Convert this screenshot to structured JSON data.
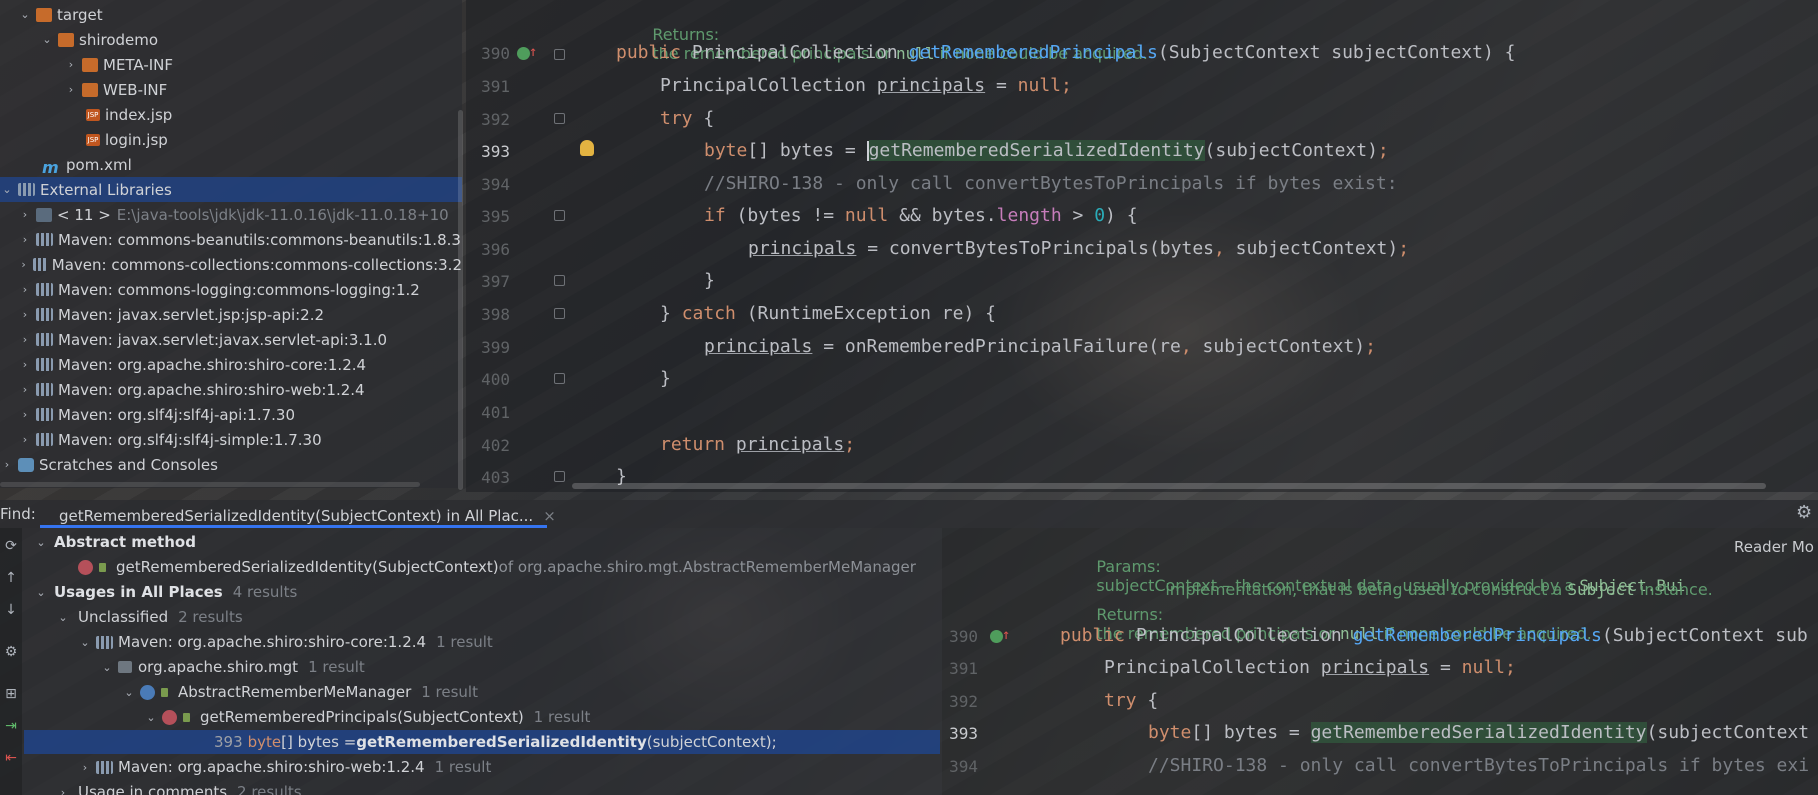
{
  "project_tree": {
    "rows": [
      {
        "label": "target",
        "dim": ""
      },
      {
        "label": "shirodemo",
        "dim": ""
      },
      {
        "label": "META-INF",
        "dim": ""
      },
      {
        "label": "WEB-INF",
        "dim": ""
      },
      {
        "label": "index.jsp",
        "dim": ""
      },
      {
        "label": "login.jsp",
        "dim": ""
      },
      {
        "label": "pom.xml",
        "dim": ""
      },
      {
        "label": "External Libraries",
        "dim": ""
      },
      {
        "label": "< 11 >",
        "dim": "E:\\java-tools\\jdk\\jdk-11.0.16\\jdk-11.0.18+10"
      },
      {
        "label": "Maven: commons-beanutils:commons-beanutils:1.8.3",
        "dim": ""
      },
      {
        "label": "Maven: commons-collections:commons-collections:3.2",
        "dim": ""
      },
      {
        "label": "Maven: commons-logging:commons-logging:1.2",
        "dim": ""
      },
      {
        "label": "Maven: javax.servlet.jsp:jsp-api:2.2",
        "dim": ""
      },
      {
        "label": "Maven: javax.servlet:javax.servlet-api:3.1.0",
        "dim": ""
      },
      {
        "label": "Maven: org.apache.shiro:shiro-core:1.2.4",
        "dim": ""
      },
      {
        "label": "Maven: org.apache.shiro:shiro-web:1.2.4",
        "dim": ""
      },
      {
        "label": "Maven: org.slf4j:slf4j-api:1.7.30",
        "dim": ""
      },
      {
        "label": "Maven: org.slf4j:slf4j-simple:1.7.30",
        "dim": ""
      },
      {
        "label": "Scratches and Consoles",
        "dim": ""
      }
    ]
  },
  "editor": {
    "doc_returns_label": "Returns:",
    "doc_returns_text_1": "the remembered principals or ",
    "doc_returns_null": "null",
    "doc_returns_text_2": " if none could be acquired.",
    "line_numbers": [
      "390",
      "391",
      "392",
      "393",
      "394",
      "395",
      "396",
      "397",
      "398",
      "399",
      "400",
      "401",
      "402",
      "403"
    ],
    "lines": {
      "l390_kw": "public",
      "l390_type": " PrincipalCollection ",
      "l390_fn": "getRememberedPrincipals",
      "l390_rest": "(SubjectContext subjectContext) {",
      "l391_type": "PrincipalCollection ",
      "l391_var": "principals",
      "l391_eq": " = ",
      "l391_null": "null",
      "l391_semi": ";",
      "l392_kw": "try",
      "l392_rest": " {",
      "l393_kw": "byte",
      "l393_mid": "[] bytes = ",
      "l393_call": "getRememberedSerializedIdentity",
      "l393_rest": "(subjectContext)",
      "l393_semi": ";",
      "l394_comment": "//SHIRO-138 - only call convertBytesToPrincipals if bytes exist:",
      "l395_kw": "if",
      "l395_a": " (bytes != ",
      "l395_null": "null",
      "l395_b": " && bytes.",
      "l395_field": "length",
      "l395_c": " > ",
      "l395_num": "0",
      "l395_d": ") {",
      "l396_var": "principals",
      "l396_rest": " = convertBytesToPrincipals(bytes",
      "l396_comma": ",",
      "l396_rest2": " subjectContext)",
      "l396_semi": ";",
      "l397": "}",
      "l398_a": "} ",
      "l398_kw": "catch",
      "l398_rest": " (RuntimeException re) {",
      "l399_var": "principals",
      "l399_rest": " = onRememberedPrincipalFailure(re",
      "l399_comma": ",",
      "l399_rest2": " subjectContext)",
      "l399_semi": ";",
      "l400": "}",
      "l402_kw": "return",
      "l402_var": "principals",
      "l402_semi": ";",
      "l403": "}"
    }
  },
  "find": {
    "label": "Find:",
    "tab_title": "getRememberedSerializedIdentity(SubjectContext) in All Plac...",
    "tab_close": "×",
    "abstract_method": "Abstract method",
    "method_sig": "getRememberedSerializedIdentity(SubjectContext)",
    "method_of": " of org.apache.shiro.mgt.AbstractRememberMeManager",
    "usages_label": "Usages in All Places",
    "usages_count": "4 results",
    "unclassified": "Unclassified",
    "unclassified_count": "2 results",
    "shiro_core": "Maven: org.apache.shiro:shiro-core:1.2.4",
    "shiro_core_count": "1 result",
    "pkg": "org.apache.shiro.mgt",
    "pkg_count": "1 result",
    "cls": "AbstractRememberMeManager",
    "cls_count": "1 result",
    "meth": "getRememberedPrincipals(SubjectContext)",
    "meth_count": "1 result",
    "usage_line_no": "393",
    "usage_kw": "byte",
    "usage_a": "[] bytes = ",
    "usage_bold": "getRememberedSerializedIdentity",
    "usage_b": "(subjectContext);",
    "shiro_web": "Maven: org.apache.shiro:shiro-web:1.2.4",
    "shiro_web_count": "1 result",
    "comments": "Usage in comments",
    "comments_count": "2 results"
  },
  "preview": {
    "params_label": "Params:",
    "params_text_1": "subjectContext – the contextual data, usually provided by a ",
    "params_code_1": "Subject.Bui",
    "params_text_2": "implementation, that is being used to construct a ",
    "params_code_2": "Subject",
    "params_text_3": " instance.",
    "returns_label": "Returns:",
    "returns_text_1": "the remembered principals or ",
    "returns_null": "null",
    "returns_text_2": " if none could be acquired.",
    "reader_mode": "Reader Mo",
    "line_numbers": [
      "390",
      "391",
      "392",
      "393",
      "394"
    ],
    "l390_kw": "public",
    "l390_type": " PrincipalCollection ",
    "l390_fn": "getRememberedPrincipals",
    "l390_rest": "(SubjectContext sub",
    "l391_type": "PrincipalCollection ",
    "l391_var": "principals",
    "l391_eq": " = ",
    "l391_null": "null",
    "l391_semi": ";",
    "l392_kw": "try",
    "l392_rest": " {",
    "l393_kw": "byte",
    "l393_mid": "[] bytes = ",
    "l393_call": "getRememberedSerializedIdentity",
    "l393_rest": "(subjectContext",
    "l394_comment": "//SHIRO-138 - only call convertBytesToPrincipals if bytes exi"
  },
  "colors": {
    "keyword": "#cf8e6d",
    "function_decl": "#56a8f5",
    "comment": "#7a7e85",
    "number": "#2aacb8",
    "field": "#c77dbb",
    "selection": "#214283",
    "accent": "#3574f0"
  }
}
